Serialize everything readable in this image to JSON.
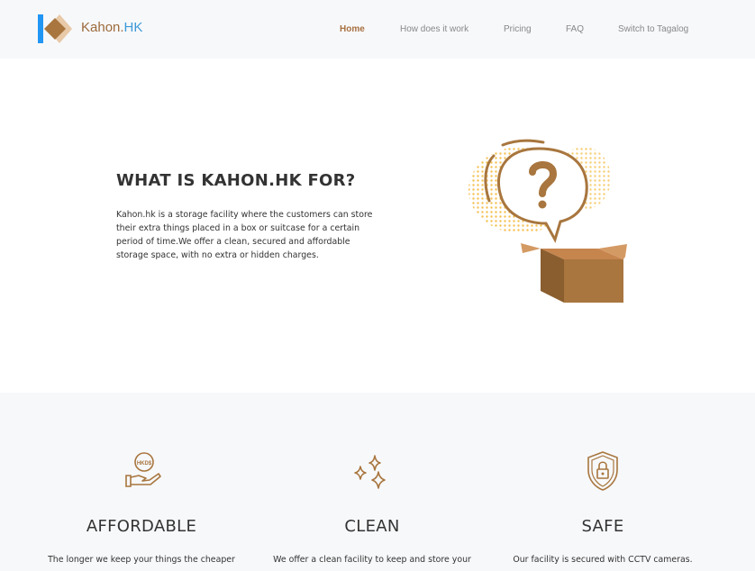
{
  "brand": {
    "name_part1": "Kahon.",
    "name_part2": "HK"
  },
  "nav": {
    "home": "Home",
    "how": "How does it work",
    "pricing": "Pricing",
    "faq": "FAQ",
    "switch": "Switch to Tagalog"
  },
  "hero": {
    "title": "WHAT IS KAHON.HK FOR?",
    "description": "Kahon.hk is a storage facility where the customers can store their extra things placed in a box or suitcase for a certain period of time.We offer a clean, secured and affordable storage space, with no extra or hidden charges.",
    "illustration_icon": "question-box-icon"
  },
  "features": [
    {
      "icon": "hkd-hand-icon",
      "icon_text": "HKD$",
      "title": "AFFORDABLE",
      "desc": "The longer we keep your things the cheaper"
    },
    {
      "icon": "sparkle-icon",
      "title": "CLEAN",
      "desc": "We offer a clean facility to keep and store your"
    },
    {
      "icon": "shield-lock-icon",
      "title": "SAFE",
      "desc": "Our facility is secured with CCTV cameras."
    }
  ],
  "colors": {
    "accent": "#a77040",
    "logo_blue": "#3d9ad8",
    "box_brown": "#a8763e"
  }
}
